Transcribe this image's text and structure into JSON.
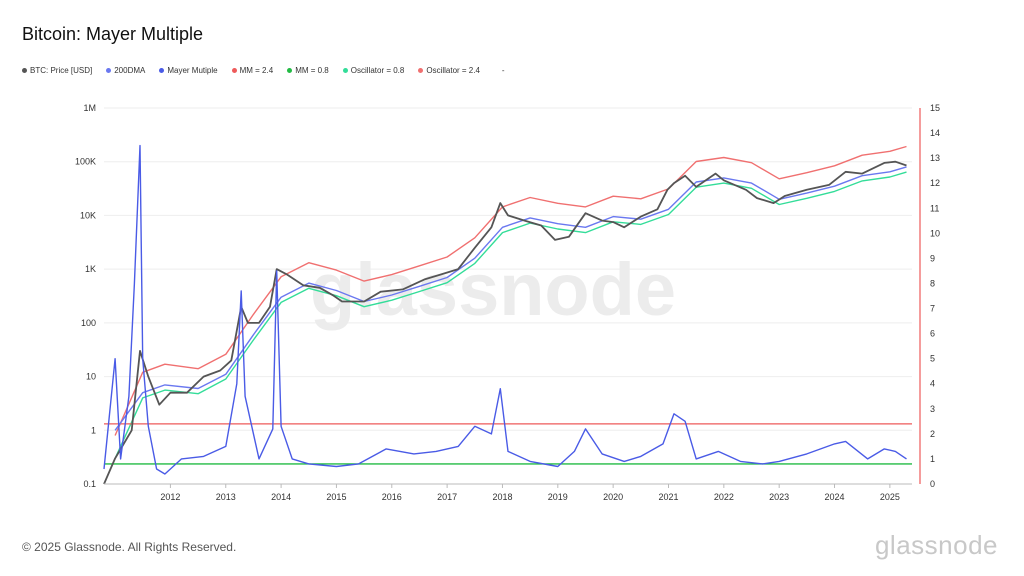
{
  "chart_data": {
    "type": "line",
    "title": "Bitcoin: Mayer Multiple",
    "watermark": "glassnode",
    "legend": [
      {
        "name": "BTC: Price [USD]",
        "color": "#555555"
      },
      {
        "name": "200DMA",
        "color": "#6a78f0"
      },
      {
        "name": "Mayer Mutiple",
        "color": "#4a5be6"
      },
      {
        "name": "MM = 2.4",
        "color": "#ee5a5a"
      },
      {
        "name": "MM = 0.8",
        "color": "#22bb44"
      },
      {
        "name": "Oscillator = 0.8",
        "color": "#33dd99"
      },
      {
        "name": "Oscillator = 2.4",
        "color": "#f07070"
      },
      {
        "name": "-",
        "color": "#ffffff"
      }
    ],
    "x_axis": {
      "ticks": [
        "2012",
        "2013",
        "2014",
        "2015",
        "2016",
        "2017",
        "2018",
        "2019",
        "2020",
        "2021",
        "2022",
        "2023",
        "2024",
        "2025"
      ],
      "range": [
        2010.8,
        2025.4
      ]
    },
    "y_left": {
      "scale": "log",
      "ticks": [
        "0.1",
        "1",
        "10",
        "100",
        "1K",
        "10K",
        "100K",
        "1M"
      ],
      "range": [
        0.1,
        1000000
      ]
    },
    "y_right": {
      "ticks": [
        "0",
        "1",
        "2",
        "3",
        "4",
        "5",
        "6",
        "7",
        "8",
        "9",
        "10",
        "11",
        "12",
        "13",
        "14",
        "15"
      ],
      "range": [
        0,
        15
      ]
    },
    "series": [
      {
        "name": "BTC: Price [USD]",
        "axis": "left",
        "color": "#555555",
        "x": [
          2010.8,
          2011.0,
          2011.3,
          2011.45,
          2011.6,
          2011.8,
          2012.0,
          2012.3,
          2012.6,
          2012.9,
          2013.1,
          2013.28,
          2013.4,
          2013.6,
          2013.8,
          2013.92,
          2014.1,
          2014.4,
          2014.7,
          2014.95,
          2015.1,
          2015.5,
          2015.8,
          2016.2,
          2016.6,
          2016.9,
          2017.2,
          2017.5,
          2017.8,
          2017.96,
          2018.1,
          2018.4,
          2018.7,
          2018.95,
          2019.2,
          2019.5,
          2019.8,
          2020.0,
          2020.2,
          2020.5,
          2020.8,
          2020.98,
          2021.1,
          2021.3,
          2021.5,
          2021.85,
          2022.0,
          2022.4,
          2022.6,
          2022.9,
          2023.1,
          2023.5,
          2023.9,
          2024.2,
          2024.5,
          2024.9,
          2025.1,
          2025.3
        ],
        "y": [
          0.1,
          0.3,
          1,
          30,
          10,
          3,
          5,
          5,
          10,
          13,
          20,
          200,
          100,
          100,
          200,
          1000,
          800,
          500,
          450,
          320,
          250,
          250,
          380,
          420,
          650,
          800,
          1000,
          2500,
          6000,
          17000,
          10000,
          8000,
          6500,
          3500,
          4000,
          11000,
          8000,
          7500,
          6000,
          9500,
          13000,
          30000,
          40000,
          55000,
          34000,
          60000,
          45000,
          30000,
          21000,
          17000,
          23000,
          30000,
          37000,
          65000,
          60000,
          95000,
          100000,
          85000
        ]
      },
      {
        "name": "200DMA",
        "axis": "left",
        "color": "#6a78f0",
        "x": [
          2011.0,
          2011.5,
          2011.9,
          2012.5,
          2013.0,
          2013.5,
          2014.0,
          2014.5,
          2015.0,
          2015.5,
          2016.0,
          2016.5,
          2017.0,
          2017.5,
          2018.0,
          2018.5,
          2019.0,
          2019.5,
          2020.0,
          2020.5,
          2021.0,
          2021.5,
          2022.0,
          2022.5,
          2023.0,
          2023.5,
          2024.0,
          2024.5,
          2025.0,
          2025.3
        ],
        "y": [
          1,
          5,
          7,
          6,
          11,
          60,
          300,
          550,
          400,
          250,
          330,
          480,
          700,
          1600,
          6000,
          9000,
          7000,
          6000,
          9500,
          8500,
          13000,
          42000,
          50000,
          40000,
          20000,
          26000,
          35000,
          55000,
          65000,
          80000
        ]
      },
      {
        "name": "Mayer Mutiple",
        "axis": "right",
        "color": "#4a5be6",
        "x": [
          2010.8,
          2011.0,
          2011.1,
          2011.25,
          2011.35,
          2011.45,
          2011.5,
          2011.6,
          2011.75,
          2011.9,
          2012.2,
          2012.6,
          2013.0,
          2013.2,
          2013.28,
          2013.35,
          2013.6,
          2013.85,
          2013.92,
          2014.0,
          2014.2,
          2014.5,
          2015.0,
          2015.4,
          2015.9,
          2016.4,
          2016.8,
          2017.2,
          2017.5,
          2017.8,
          2017.96,
          2018.1,
          2018.5,
          2019.0,
          2019.3,
          2019.5,
          2019.8,
          2020.2,
          2020.5,
          2020.9,
          2021.1,
          2021.3,
          2021.5,
          2021.9,
          2022.3,
          2022.7,
          2023.0,
          2023.5,
          2024.0,
          2024.2,
          2024.6,
          2024.9,
          2025.1,
          2025.3
        ],
        "y": [
          0.6,
          5.0,
          1.0,
          3.5,
          8.0,
          13.5,
          5.0,
          2.3,
          0.6,
          0.4,
          1.0,
          1.1,
          1.5,
          4.0,
          7.7,
          3.5,
          1.0,
          2.2,
          8.5,
          2.3,
          1.0,
          0.8,
          0.7,
          0.8,
          1.4,
          1.2,
          1.3,
          1.5,
          2.3,
          2.0,
          3.8,
          1.3,
          0.9,
          0.7,
          1.3,
          2.2,
          1.2,
          0.9,
          1.1,
          1.6,
          2.8,
          2.5,
          1.0,
          1.3,
          0.9,
          0.8,
          0.9,
          1.2,
          1.6,
          1.7,
          1.0,
          1.4,
          1.3,
          1.0
        ]
      },
      {
        "name": "MM = 2.4",
        "axis": "right",
        "color": "#ee5a5a",
        "constant": 2.4
      },
      {
        "name": "MM = 0.8",
        "axis": "right",
        "color": "#22bb44",
        "constant": 0.8
      },
      {
        "name": "Oscillator = 0.8",
        "axis": "left",
        "color": "#33dd99",
        "x": [
          2011.0,
          2011.5,
          2011.9,
          2012.5,
          2013.0,
          2013.5,
          2014.0,
          2014.5,
          2015.0,
          2015.5,
          2016.0,
          2016.5,
          2017.0,
          2017.5,
          2018.0,
          2018.5,
          2019.0,
          2019.5,
          2020.0,
          2020.5,
          2021.0,
          2021.5,
          2022.0,
          2022.5,
          2023.0,
          2023.5,
          2024.0,
          2024.5,
          2025.0,
          2025.3
        ],
        "y": [
          0.3,
          4,
          5.6,
          4.8,
          9,
          48,
          240,
          440,
          320,
          200,
          264,
          384,
          560,
          1280,
          4800,
          7200,
          5600,
          4800,
          7600,
          6800,
          10400,
          33600,
          40000,
          32000,
          16000,
          20800,
          28000,
          44000,
          52000,
          64000
        ]
      },
      {
        "name": "Oscillator = 2.4",
        "axis": "left",
        "color": "#f07070",
        "x": [
          2011.0,
          2011.5,
          2011.9,
          2012.5,
          2013.0,
          2013.5,
          2014.0,
          2014.5,
          2015.0,
          2015.5,
          2016.0,
          2016.5,
          2017.0,
          2017.5,
          2018.0,
          2018.5,
          2019.0,
          2019.5,
          2020.0,
          2020.5,
          2021.0,
          2021.5,
          2022.0,
          2022.5,
          2023.0,
          2023.5,
          2024.0,
          2024.5,
          2025.0,
          2025.3
        ],
        "y": [
          0.8,
          12,
          17,
          14,
          26,
          144,
          720,
          1320,
          960,
          600,
          792,
          1152,
          1680,
          3840,
          14400,
          21600,
          16800,
          14400,
          22800,
          20400,
          31200,
          100800,
          120000,
          96000,
          48000,
          62400,
          84000,
          132000,
          156000,
          192000
        ]
      }
    ]
  },
  "footer": {
    "copyright": "© 2025 Glassnode. All Rights Reserved.",
    "brand": "glassnode"
  }
}
